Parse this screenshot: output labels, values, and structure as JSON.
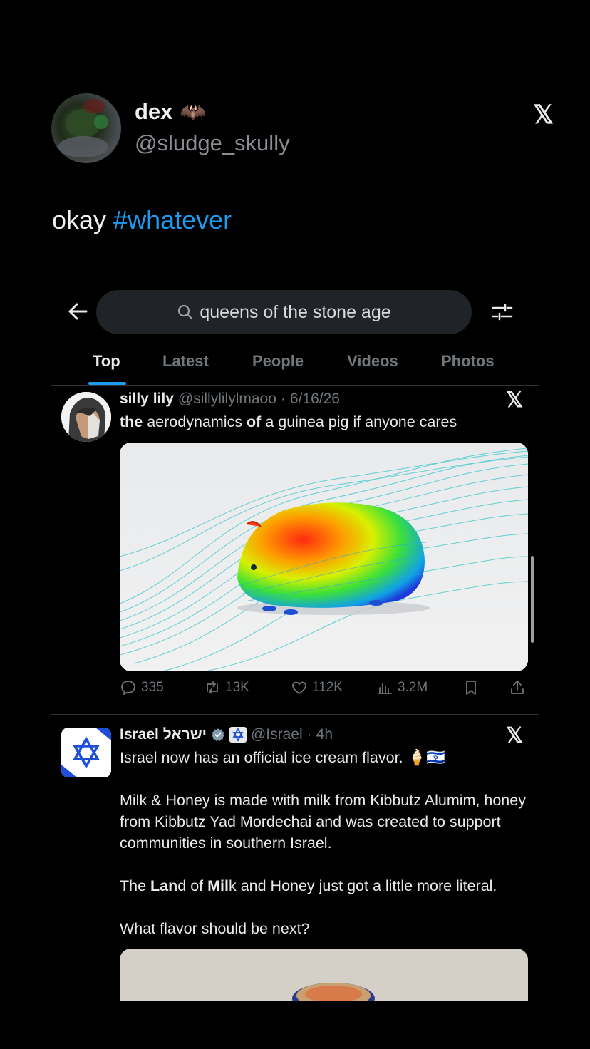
{
  "outer_post": {
    "author_name": "dex",
    "author_emoji": "🦇",
    "author_handle": "@sludge_skully",
    "text_prefix": "okay ",
    "hashtag": "#whatever",
    "x_logo": "𝕏"
  },
  "search": {
    "query": "queens of the stone age",
    "icons": [
      "back-arrow-icon",
      "search-icon",
      "filter-icon"
    ]
  },
  "tabs": [
    {
      "label": "Top",
      "active": true
    },
    {
      "label": "Latest",
      "active": false
    },
    {
      "label": "People",
      "active": false
    },
    {
      "label": "Videos",
      "active": false
    },
    {
      "label": "Photos",
      "active": false
    }
  ],
  "post1": {
    "name": "silly lily",
    "handle": "@sillylilylmaoo",
    "date": "6/16/26",
    "text_parts": [
      "the",
      " aerodynamics ",
      "of",
      " a guinea pig if anyone cares"
    ],
    "x_logo": "𝕏",
    "stats": {
      "replies": "335",
      "reposts": "13K",
      "likes": "112K",
      "views": "3.2M"
    }
  },
  "post2": {
    "name": "Israel ישראל",
    "handle": "@Israel",
    "time": "4h",
    "x_logo": "𝕏",
    "line1": "Israel now has an official ice cream flavor.",
    "line1_emoji": "🍦🇮🇱",
    "para2": "Milk & Honey is made with milk from Kibbutz Alumim, honey from Kibbutz Yad Mordechai and was created to support communities in southern Israel.",
    "para3_parts": [
      "The ",
      "Lan",
      "d of ",
      "Mil",
      "k and Honey just got a little more literal."
    ],
    "para4": "What flavor should be next?"
  },
  "colors": {
    "accent": "#1d9bf0",
    "background": "#000000",
    "muted": "#71767b",
    "text": "#e7e9ea"
  }
}
